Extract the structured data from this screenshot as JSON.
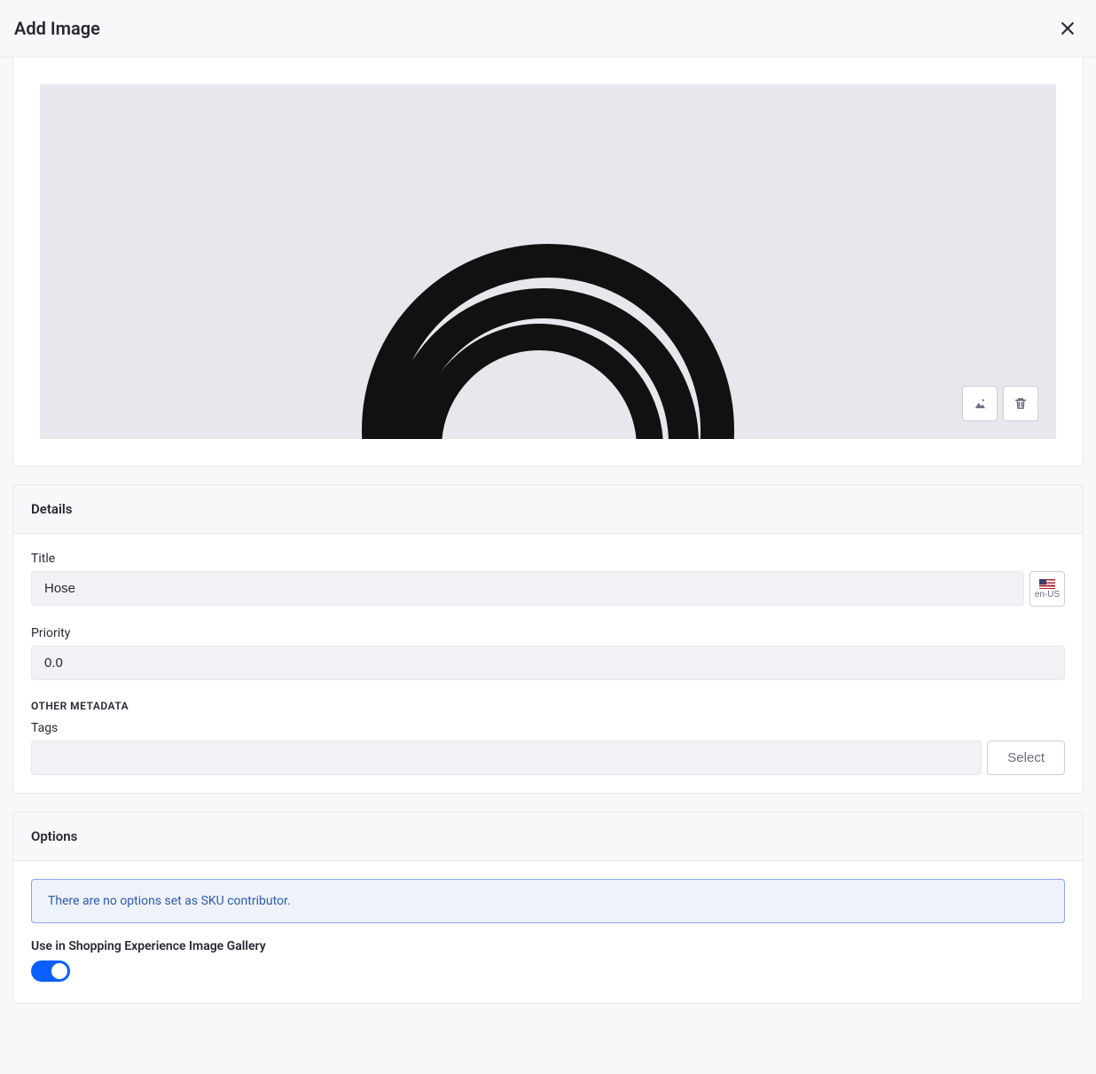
{
  "header": {
    "title": "Add Image"
  },
  "details": {
    "heading": "Details",
    "title_label": "Title",
    "title_value": "Hose",
    "locale_code": "en-US",
    "priority_label": "Priority",
    "priority_value": "0.0",
    "other_metadata_label": "OTHER METADATA",
    "tags_label": "Tags",
    "tags_value": "",
    "select_label": "Select"
  },
  "options": {
    "heading": "Options",
    "no_options_message": "There are no options set as SKU contributor.",
    "gallery_toggle_label": "Use in Shopping Experience Image Gallery",
    "gallery_toggle_on": true
  }
}
